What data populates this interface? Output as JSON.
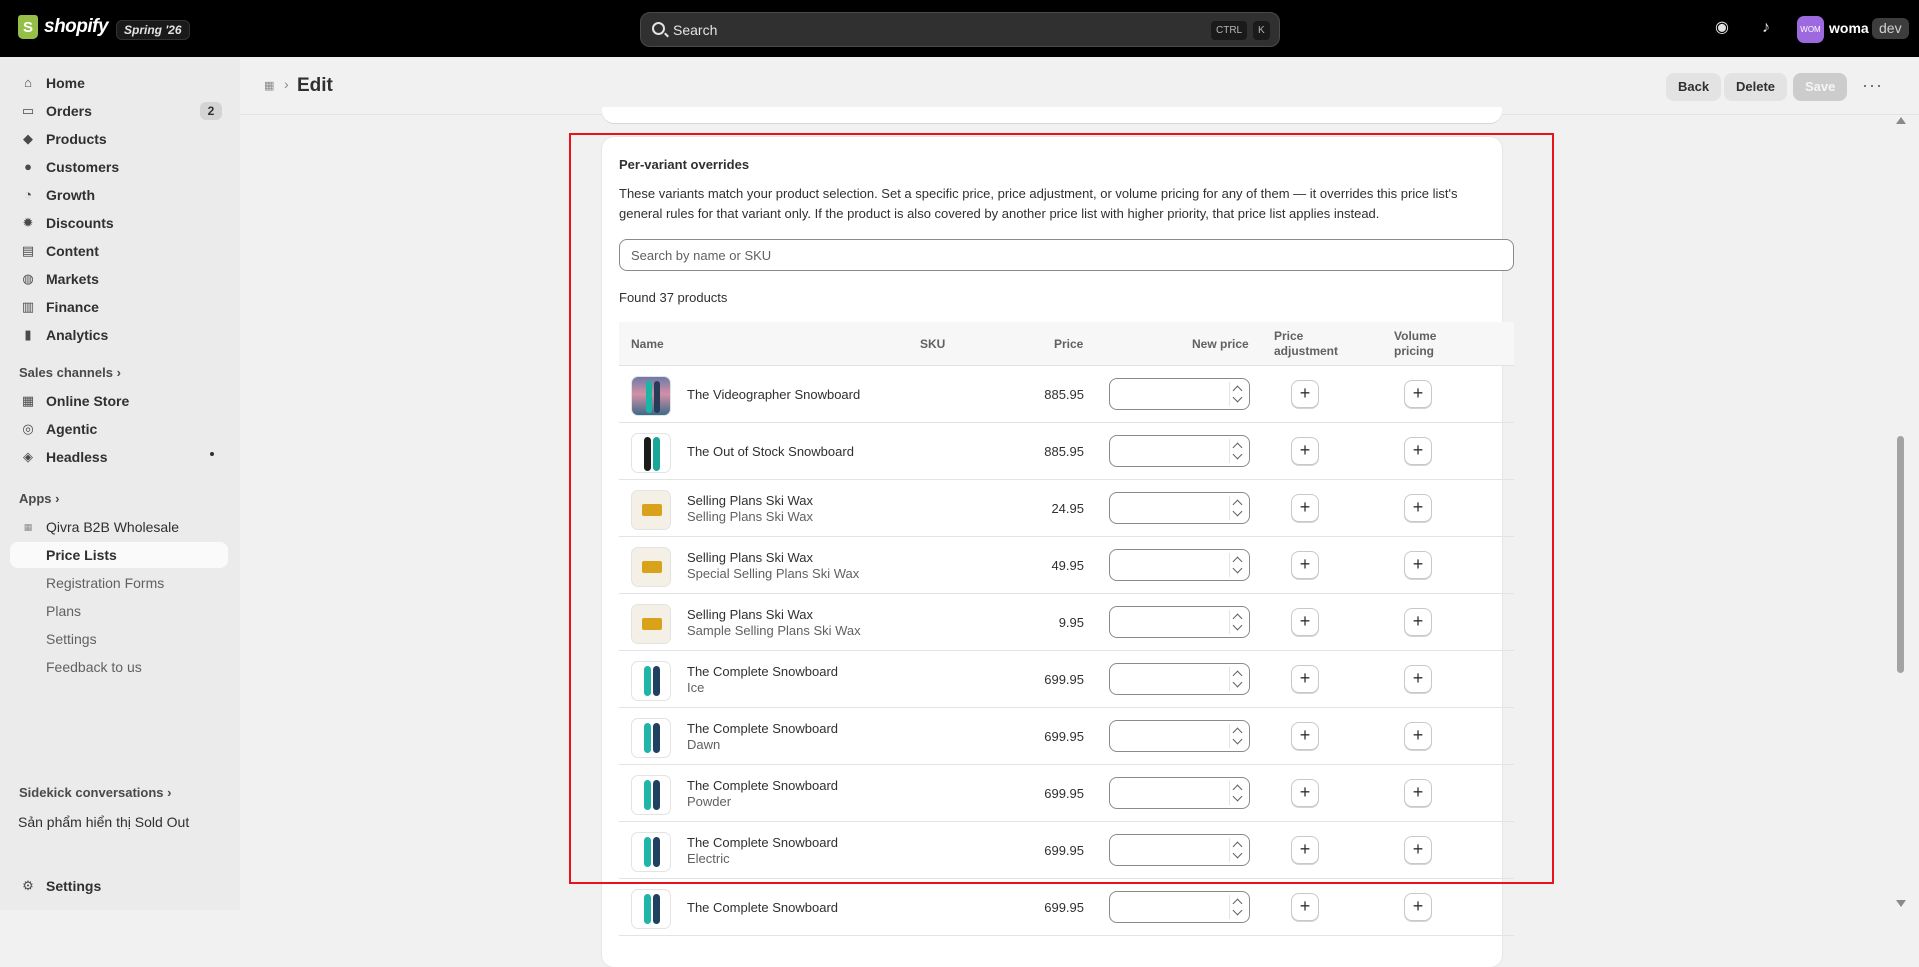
{
  "topbar": {
    "logo_text": "shopify",
    "edition": "Spring '26",
    "search_placeholder": "Search",
    "shortcut_1": "CTRL",
    "shortcut_2": "K",
    "avatar_initials": "WOM",
    "user_name": "woma",
    "env_tag": "dev"
  },
  "sidebar": {
    "nav": [
      {
        "label": "Home",
        "icon": "home-icon"
      },
      {
        "label": "Orders",
        "icon": "orders-icon",
        "count": "2"
      },
      {
        "label": "Products",
        "icon": "tag-icon"
      },
      {
        "label": "Customers",
        "icon": "person-icon"
      },
      {
        "label": "Growth",
        "icon": "growth-icon"
      },
      {
        "label": "Discounts",
        "icon": "discount-icon"
      },
      {
        "label": "Content",
        "icon": "content-icon"
      },
      {
        "label": "Markets",
        "icon": "globe-icon"
      },
      {
        "label": "Finance",
        "icon": "bank-icon"
      },
      {
        "label": "Analytics",
        "icon": "bar-chart-icon"
      }
    ],
    "sales_channels_label": "Sales channels",
    "channels": [
      {
        "label": "Online Store",
        "icon": "store-icon"
      },
      {
        "label": "Agentic",
        "icon": "agentic-icon"
      },
      {
        "label": "Headless",
        "icon": "headless-icon"
      }
    ],
    "apps_label": "Apps",
    "app_name": "Qivra B2B Wholesale",
    "app_items": [
      "Price Lists",
      "Registration Forms",
      "Plans",
      "Settings",
      "Feedback to us"
    ],
    "sidekick_label": "Sidekick conversations",
    "sidekick_item": "Sản phẩm hiển thị Sold Out",
    "settings_label": "Settings"
  },
  "page": {
    "title": "Edit",
    "back_label": "Back",
    "delete_label": "Delete",
    "save_label": "Save"
  },
  "card": {
    "title": "Per-variant overrides",
    "description": "These variants match your product selection. Set a specific price, price adjustment, or volume pricing for any of them — it overrides this price list's general rules for that variant only. If the product is also covered by another price list with higher priority, that price list applies instead.",
    "search_placeholder": "Search by name or SKU",
    "found_text": "Found 37 products",
    "columns": {
      "name": "Name",
      "sku": "SKU",
      "price": "Price",
      "new_price": "New price",
      "price_adjustment_1": "Price",
      "price_adjustment_2": "adjustment",
      "volume_pricing_1": "Volume",
      "volume_pricing_2": "pricing"
    },
    "rows": [
      {
        "name": "The Videographer Snowboard",
        "variant": "",
        "sku": "",
        "price": "885.95",
        "thumb": "photo"
      },
      {
        "name": "The Out of Stock Snowboard",
        "variant": "",
        "sku": "",
        "price": "885.95",
        "thumb": "dark"
      },
      {
        "name": "Selling Plans Ski Wax",
        "variant": "Selling Plans Ski Wax",
        "sku": "",
        "price": "24.95",
        "thumb": "wax"
      },
      {
        "name": "Selling Plans Ski Wax",
        "variant": "Special Selling Plans Ski Wax",
        "sku": "",
        "price": "49.95",
        "thumb": "wax"
      },
      {
        "name": "Selling Plans Ski Wax",
        "variant": "Sample Selling Plans Ski Wax",
        "sku": "",
        "price": "9.95",
        "thumb": "wax"
      },
      {
        "name": "The Complete Snowboard",
        "variant": "Ice",
        "sku": "",
        "price": "699.95",
        "thumb": "board"
      },
      {
        "name": "The Complete Snowboard",
        "variant": "Dawn",
        "sku": "",
        "price": "699.95",
        "thumb": "board"
      },
      {
        "name": "The Complete Snowboard",
        "variant": "Powder",
        "sku": "",
        "price": "699.95",
        "thumb": "board"
      },
      {
        "name": "The Complete Snowboard",
        "variant": "Electric",
        "sku": "",
        "price": "699.95",
        "thumb": "board"
      },
      {
        "name": "The Complete Snowboard",
        "variant": "",
        "sku": "",
        "price": "699.95",
        "thumb": "board"
      }
    ]
  },
  "colors": {
    "highlight": "#e8141b",
    "brand_green": "#95bf47",
    "avatar": "#9c6ade"
  }
}
